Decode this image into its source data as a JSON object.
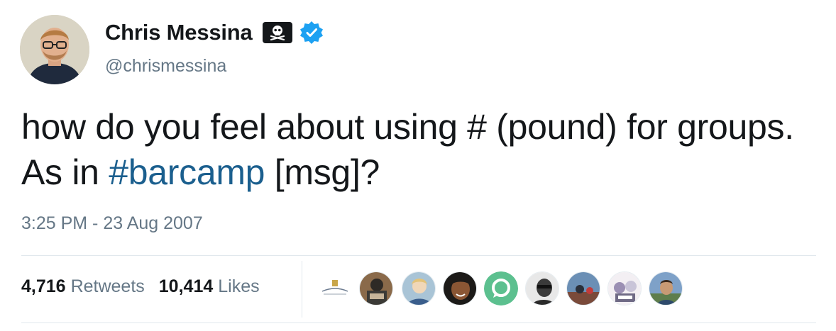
{
  "author": {
    "name": "Chris Messina",
    "handle": "@chrismessina",
    "verified": true,
    "flag_icon": "pirate-flag-icon"
  },
  "tweet": {
    "text_part1": "how do you feel about using # (pound) for groups. As in ",
    "hashtag": "#barcamp",
    "text_part2": " [msg]?",
    "timestamp": "3:25 PM - 23 Aug 2007"
  },
  "stats": {
    "retweets_count": "4,716",
    "retweets_label": "Retweets",
    "likes_count": "10,414",
    "likes_label": "Likes"
  },
  "likers": [
    {
      "name": "liker-1"
    },
    {
      "name": "liker-2"
    },
    {
      "name": "liker-3"
    },
    {
      "name": "liker-4"
    },
    {
      "name": "liker-5"
    },
    {
      "name": "liker-6"
    },
    {
      "name": "liker-7"
    },
    {
      "name": "liker-8"
    },
    {
      "name": "liker-9"
    }
  ],
  "colors": {
    "hashtag": "#1b5f8e",
    "secondary_text": "#657786",
    "verified_badge": "#1da1f2",
    "divider": "#e1e8ed"
  }
}
